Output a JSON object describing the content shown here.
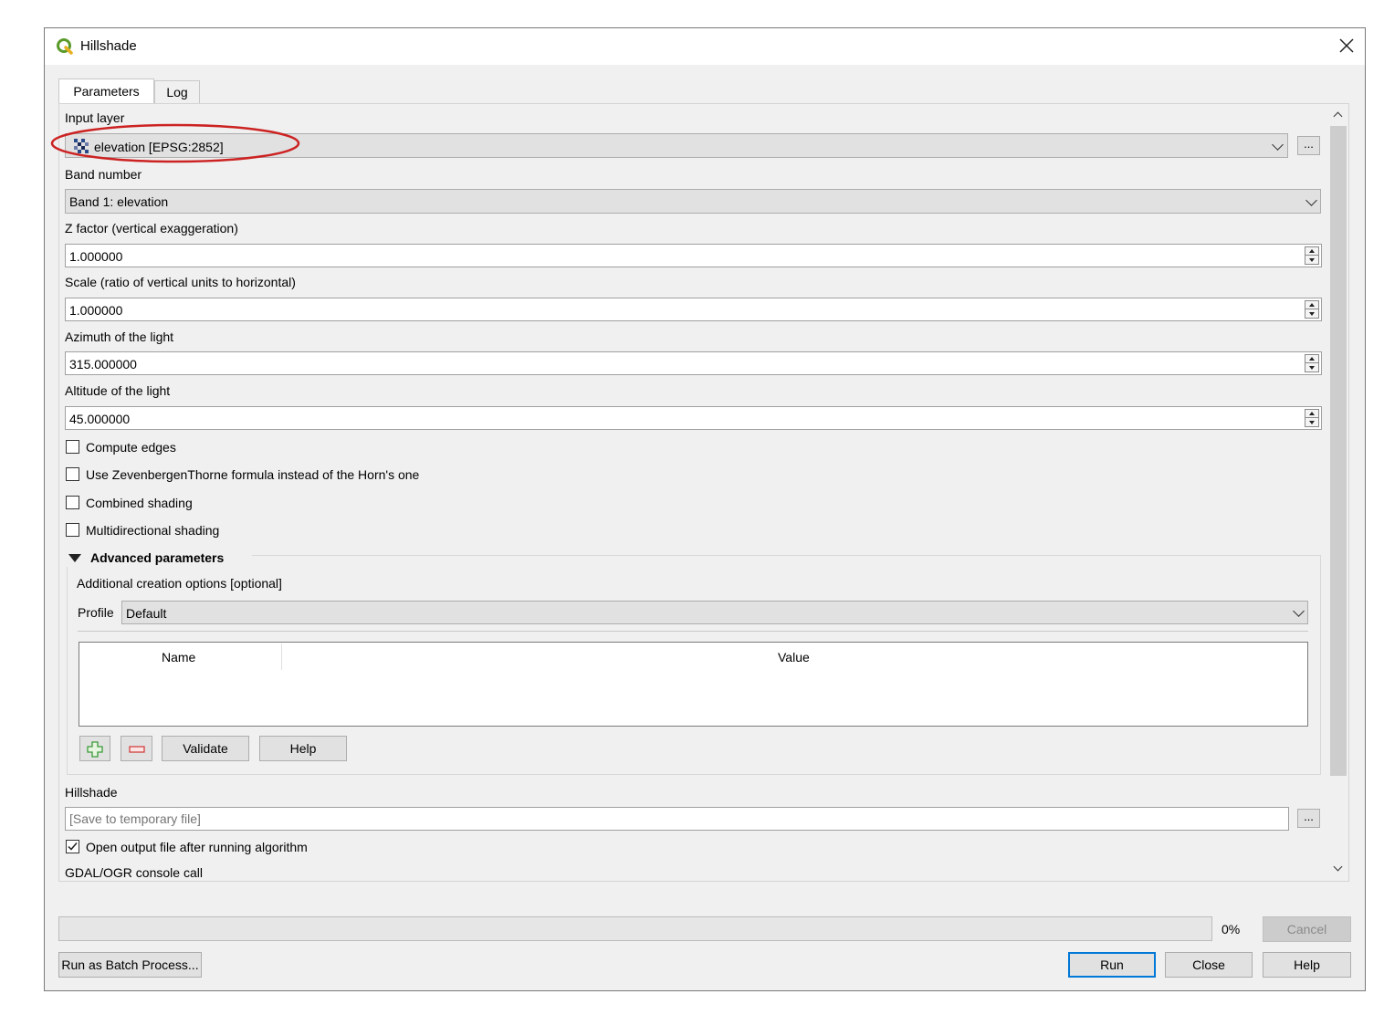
{
  "window": {
    "title": "Hillshade",
    "icon": "qgis-logo-icon"
  },
  "tabs": [
    {
      "label": "Parameters",
      "active": true
    },
    {
      "label": "Log",
      "active": false
    }
  ],
  "params": {
    "input_layer": {
      "label": "Input layer",
      "value": "elevation [EPSG:2852]",
      "annotation": "red ellipse highlight"
    },
    "band": {
      "label": "Band number",
      "value": "Band 1: elevation"
    },
    "zfactor": {
      "label": "Z factor (vertical exaggeration)",
      "value": "1.000000"
    },
    "scale": {
      "label": "Scale (ratio of vertical units to horizontal)",
      "value": "1.000000"
    },
    "azimuth": {
      "label": "Azimuth of the light",
      "value": "315.000000"
    },
    "altitude": {
      "label": "Altitude of the light",
      "value": "45.000000"
    },
    "checkboxes": [
      {
        "label": "Compute edges",
        "checked": false
      },
      {
        "label": "Use ZevenbergenThorne formula instead of the Horn's one",
        "checked": false
      },
      {
        "label": "Combined shading",
        "checked": false
      },
      {
        "label": "Multidirectional shading",
        "checked": false
      }
    ],
    "advanced": {
      "title": "Advanced parameters",
      "creation_options_label": "Additional creation options [optional]",
      "profile_label": "Profile",
      "profile_value": "Default",
      "table_headers": [
        "Name",
        "Value"
      ],
      "validate_label": "Validate",
      "help_label": "Help"
    },
    "output": {
      "label": "Hillshade",
      "placeholder": "[Save to temporary file]"
    },
    "open_output": {
      "label": "Open output file after running algorithm",
      "checked": true
    },
    "console_label": "GDAL/OGR console call",
    "browse_label": "..."
  },
  "footer": {
    "progress_percent": 0,
    "progress_text": "0%",
    "cancel_label": "Cancel",
    "batch_label": "Run as Batch Process...",
    "run_label": "Run",
    "close_label": "Close",
    "help_label": "Help"
  },
  "colors": {
    "annotation": "#cc2222",
    "run_border": "#0078d7",
    "plus": "#3a9a3a",
    "minus": "#d04040"
  }
}
